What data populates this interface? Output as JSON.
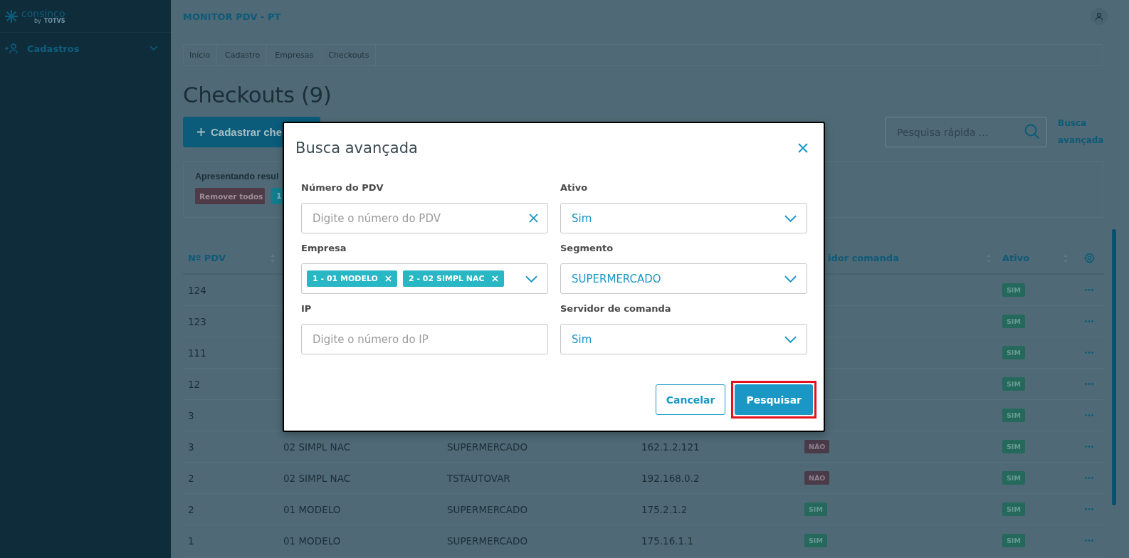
{
  "sidebar": {
    "logo": {
      "name": "consinco",
      "by": "by",
      "brand": "TOTVS"
    },
    "menu": [
      {
        "label": "Cadastros",
        "expanded": false
      }
    ]
  },
  "header": {
    "title": "MONITOR PDV - PT"
  },
  "breadcrumb": [
    "Início",
    "Cadastro",
    "Empresas",
    "Checkouts"
  ],
  "page_title": "Checkouts (9)",
  "new_button": "Cadastrar che",
  "search": {
    "placeholder": "Pesquisa rápida ..."
  },
  "advanced_link": "Busca avançada",
  "filters": {
    "summary": "Apresentando resul",
    "remove_all": "Remover todos",
    "chips": [
      "1"
    ]
  },
  "table": {
    "columns": [
      {
        "label": "Nº PDV",
        "sortable": true
      },
      {
        "label": "idor comanda",
        "sortable": true
      },
      {
        "label": "Ativo",
        "sortable": true
      }
    ],
    "rows": [
      {
        "pdv": "124",
        "ativo": "SIM",
        "ativo_on": true
      },
      {
        "pdv": "123",
        "ativo": "SIM",
        "ativo_on": true
      },
      {
        "pdv": "111",
        "ativo": "SIM",
        "ativo_on": true
      },
      {
        "pdv": "12",
        "ativo": "SIM",
        "ativo_on": true
      },
      {
        "pdv": "3",
        "ativo": "SIM",
        "ativo_on": true
      },
      {
        "pdv": "3",
        "empresa": "02 SIMPL NAC",
        "segmento": "SUPERMERCADO",
        "ip": "162.1.2.121",
        "servidor": "NÃO",
        "servidor_on": false,
        "ativo": "SIM",
        "ativo_on": true
      },
      {
        "pdv": "2",
        "empresa": "02 SIMPL NAC",
        "segmento": "TSTAUTOVAR",
        "ip": "192.168.0.2",
        "servidor": "NÃO",
        "servidor_on": false,
        "ativo": "SIM",
        "ativo_on": true
      },
      {
        "pdv": "2",
        "empresa": "01 MODELO",
        "segmento": "SUPERMERCADO",
        "ip": "175.2.1.2",
        "servidor": "SIM",
        "servidor_on": true,
        "ativo": "SIM",
        "ativo_on": true
      },
      {
        "pdv": "1",
        "empresa": "01 MODELO",
        "segmento": "SUPERMERCADO",
        "ip": "175.16.1.1",
        "servidor": "SIM",
        "servidor_on": true,
        "ativo": "SIM",
        "ativo_on": true
      }
    ]
  },
  "modal": {
    "title": "Busca avançada",
    "fields": [
      {
        "kind": "text",
        "label": "Número do PDV",
        "placeholder": "Digite o número do PDV",
        "clearable": true
      },
      {
        "kind": "select",
        "label": "Ativo",
        "value": "Sim"
      },
      {
        "kind": "multiselect",
        "label": "Empresa",
        "chips": [
          "1 - 01 MODELO",
          "2 - 02 SIMPL NAC"
        ]
      },
      {
        "kind": "select",
        "label": "Segmento",
        "value": "SUPERMERCADO"
      },
      {
        "kind": "text",
        "label": "IP",
        "placeholder": "Digite o número do IP",
        "clearable": false
      },
      {
        "kind": "select",
        "label": "Servidor de comanda",
        "value": "Sim"
      }
    ],
    "buttons": [
      {
        "label": "Cancelar",
        "kind": "secondary",
        "highlighted": false
      },
      {
        "label": "Pesquisar",
        "kind": "primary",
        "highlighted": true
      }
    ]
  }
}
